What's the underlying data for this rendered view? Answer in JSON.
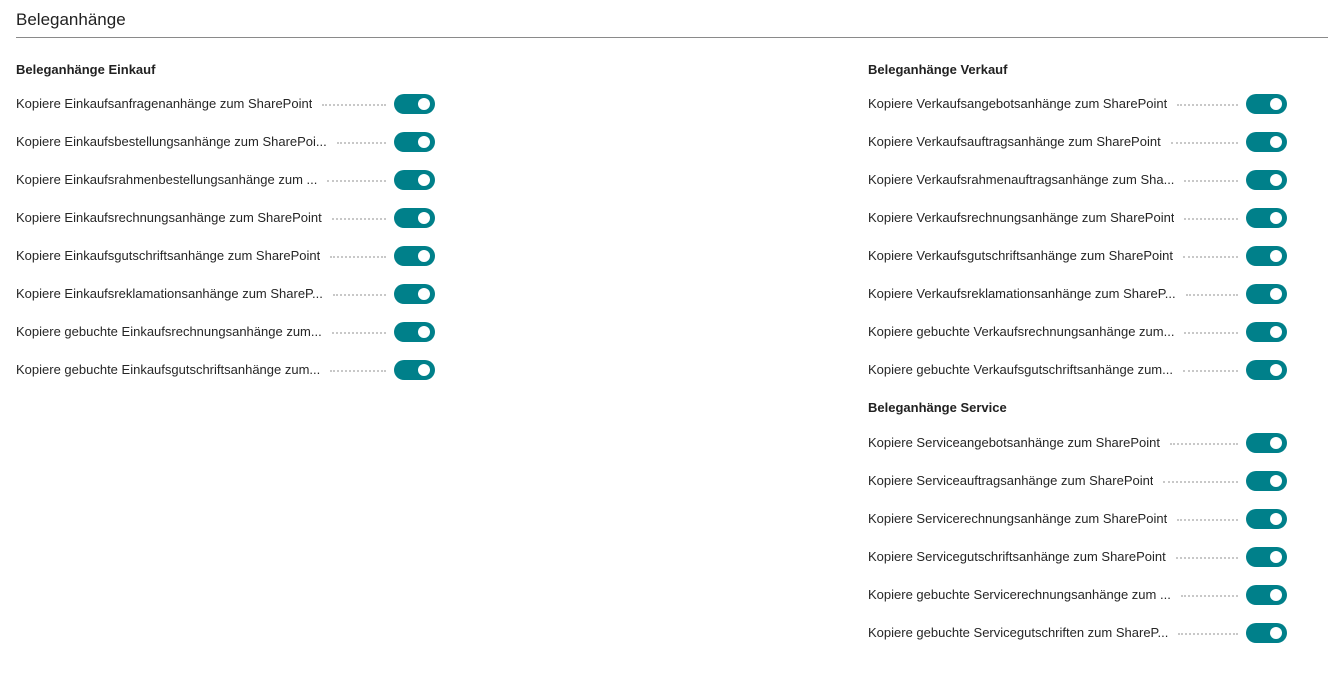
{
  "page": {
    "title": "Beleganhänge"
  },
  "accent_color": "#00808a",
  "groups": {
    "einkauf": {
      "title": "Beleganhänge Einkauf",
      "items": [
        {
          "label": "Kopiere Einkaufsanfragenanhänge zum SharePoint",
          "enabled": true
        },
        {
          "label": "Kopiere Einkaufsbestellungsanhänge zum SharePoi...",
          "enabled": true
        },
        {
          "label": "Kopiere Einkaufsrahmenbestellungsanhänge zum ...",
          "enabled": true
        },
        {
          "label": "Kopiere Einkaufsrechnungsanhänge zum SharePoint",
          "enabled": true
        },
        {
          "label": "Kopiere Einkaufsgutschriftsanhänge zum SharePoint",
          "enabled": true
        },
        {
          "label": "Kopiere Einkaufsreklamationsanhänge zum ShareP...",
          "enabled": true
        },
        {
          "label": "Kopiere gebuchte Einkaufsrechnungsanhänge zum...",
          "enabled": true
        },
        {
          "label": "Kopiere gebuchte Einkaufsgutschriftsanhänge zum...",
          "enabled": true
        }
      ]
    },
    "verkauf": {
      "title": "Beleganhänge Verkauf",
      "items": [
        {
          "label": "Kopiere Verkaufsangebotsanhänge zum SharePoint",
          "enabled": true
        },
        {
          "label": "Kopiere Verkaufsauftragsanhänge zum SharePoint",
          "enabled": true
        },
        {
          "label": "Kopiere Verkaufsrahmenauftragsanhänge zum Sha...",
          "enabled": true
        },
        {
          "label": "Kopiere Verkaufsrechnungsanhänge zum SharePoint",
          "enabled": true
        },
        {
          "label": "Kopiere Verkaufsgutschriftsanhänge zum SharePoint",
          "enabled": true
        },
        {
          "label": "Kopiere Verkaufsreklamationsanhänge zum ShareP...",
          "enabled": true
        },
        {
          "label": "Kopiere gebuchte Verkaufsrechnungsanhänge zum...",
          "enabled": true
        },
        {
          "label": "Kopiere gebuchte Verkaufsgutschriftsanhänge zum...",
          "enabled": true
        }
      ]
    },
    "service": {
      "title": "Beleganhänge Service",
      "items": [
        {
          "label": "Kopiere Serviceangebotsanhänge zum SharePoint",
          "enabled": true
        },
        {
          "label": "Kopiere Serviceauftragsanhänge zum SharePoint",
          "enabled": true
        },
        {
          "label": "Kopiere Servicerechnungsanhänge zum SharePoint",
          "enabled": true
        },
        {
          "label": "Kopiere Servicegutschriftsanhänge zum SharePoint",
          "enabled": true
        },
        {
          "label": "Kopiere gebuchte Servicerechnungsanhänge zum ...",
          "enabled": true
        },
        {
          "label": "Kopiere gebuchte Servicegutschriften zum ShareP...",
          "enabled": true
        }
      ]
    }
  }
}
